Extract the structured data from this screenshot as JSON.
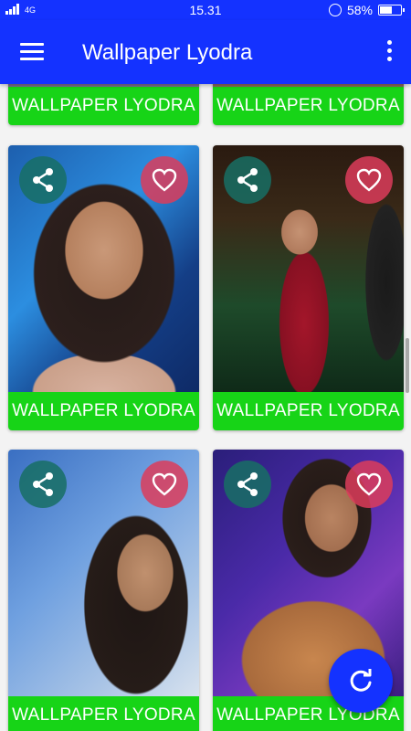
{
  "status_bar": {
    "network": "4G",
    "time": "15.31",
    "battery": "58%",
    "battery_level": 0.58
  },
  "app_bar": {
    "title": "Wallpaper Lyodra",
    "menu_icon": "hamburger-menu-icon",
    "overflow_icon": "more-vert-icon"
  },
  "cards": [
    {
      "label": "WALLPAPER LYODRA"
    },
    {
      "label": "WALLPAPER LYODRA"
    },
    {
      "label": "WALLPAPER LYODRA"
    },
    {
      "label": "WALLPAPER LYODRA"
    },
    {
      "label": "WALLPAPER LYODRA"
    },
    {
      "label": "WALLPAPER LYODRA"
    }
  ],
  "card_icons": {
    "share": "share-icon",
    "favorite": "heart-icon"
  },
  "fab": {
    "icon": "refresh-icon"
  },
  "colors": {
    "primary": "#1432ff",
    "label_bar": "#17d417",
    "share_button": "#186e64",
    "favorite_button": "#dc3c5a"
  }
}
